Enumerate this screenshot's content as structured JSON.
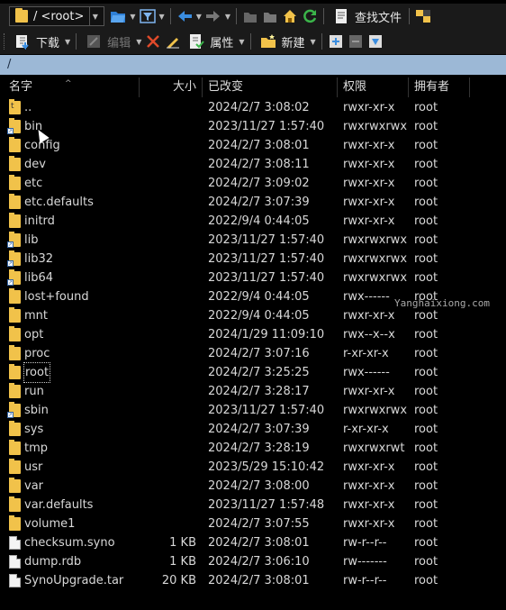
{
  "toolbar1": {
    "path_combo": "/ <root>",
    "find_files_label": "查找文件"
  },
  "toolbar2": {
    "download_label": "下载",
    "edit_label": "编辑",
    "properties_label": "属性",
    "new_label": "新建"
  },
  "current_path": "/",
  "columns": {
    "name": "名字",
    "size": "大小",
    "modified": "已改变",
    "permissions": "权限",
    "owner": "拥有者"
  },
  "files": [
    {
      "name": "..",
      "size": "",
      "modified": "2024/2/7 3:08:02",
      "permissions": "rwxr-xr-x",
      "owner": "root",
      "icon": "parent-folder-icon"
    },
    {
      "name": "bin",
      "size": "",
      "modified": "2023/11/27 1:57:40",
      "permissions": "rwxrwxrwx",
      "owner": "root",
      "icon": "symlink-icon"
    },
    {
      "name": "config",
      "size": "",
      "modified": "2024/2/7 3:08:01",
      "permissions": "rwxr-xr-x",
      "owner": "root",
      "icon": "folder-icon"
    },
    {
      "name": "dev",
      "size": "",
      "modified": "2024/2/7 3:08:11",
      "permissions": "rwxr-xr-x",
      "owner": "root",
      "icon": "folder-icon"
    },
    {
      "name": "etc",
      "size": "",
      "modified": "2024/2/7 3:09:02",
      "permissions": "rwxr-xr-x",
      "owner": "root",
      "icon": "folder-icon"
    },
    {
      "name": "etc.defaults",
      "size": "",
      "modified": "2024/2/7 3:07:39",
      "permissions": "rwxr-xr-x",
      "owner": "root",
      "icon": "folder-icon"
    },
    {
      "name": "initrd",
      "size": "",
      "modified": "2022/9/4 0:44:05",
      "permissions": "rwxr-xr-x",
      "owner": "root",
      "icon": "folder-icon"
    },
    {
      "name": "lib",
      "size": "",
      "modified": "2023/11/27 1:57:40",
      "permissions": "rwxrwxrwx",
      "owner": "root",
      "icon": "symlink-icon"
    },
    {
      "name": "lib32",
      "size": "",
      "modified": "2023/11/27 1:57:40",
      "permissions": "rwxrwxrwx",
      "owner": "root",
      "icon": "symlink-icon"
    },
    {
      "name": "lib64",
      "size": "",
      "modified": "2023/11/27 1:57:40",
      "permissions": "rwxrwxrwx",
      "owner": "root",
      "icon": "symlink-icon"
    },
    {
      "name": "lost+found",
      "size": "",
      "modified": "2022/9/4 0:44:05",
      "permissions": "rwx------",
      "owner": "root",
      "icon": "folder-icon"
    },
    {
      "name": "mnt",
      "size": "",
      "modified": "2022/9/4 0:44:05",
      "permissions": "rwxr-xr-x",
      "owner": "root",
      "icon": "folder-icon"
    },
    {
      "name": "opt",
      "size": "",
      "modified": "2024/1/29 11:09:10",
      "permissions": "rwx--x--x",
      "owner": "root",
      "icon": "folder-icon"
    },
    {
      "name": "proc",
      "size": "",
      "modified": "2024/2/7 3:07:16",
      "permissions": "r-xr-xr-x",
      "owner": "root",
      "icon": "folder-icon"
    },
    {
      "name": "root",
      "size": "",
      "modified": "2024/2/7 3:25:25",
      "permissions": "rwx------",
      "owner": "root",
      "icon": "folder-icon",
      "focused": true
    },
    {
      "name": "run",
      "size": "",
      "modified": "2024/2/7 3:28:17",
      "permissions": "rwxr-xr-x",
      "owner": "root",
      "icon": "folder-icon"
    },
    {
      "name": "sbin",
      "size": "",
      "modified": "2023/11/27 1:57:40",
      "permissions": "rwxrwxrwx",
      "owner": "root",
      "icon": "symlink-icon"
    },
    {
      "name": "sys",
      "size": "",
      "modified": "2024/2/7 3:07:39",
      "permissions": "r-xr-xr-x",
      "owner": "root",
      "icon": "folder-icon"
    },
    {
      "name": "tmp",
      "size": "",
      "modified": "2024/2/7 3:28:19",
      "permissions": "rwxrwxrwt",
      "owner": "root",
      "icon": "folder-icon"
    },
    {
      "name": "usr",
      "size": "",
      "modified": "2023/5/29 15:10:42",
      "permissions": "rwxr-xr-x",
      "owner": "root",
      "icon": "folder-icon"
    },
    {
      "name": "var",
      "size": "",
      "modified": "2024/2/7 3:08:00",
      "permissions": "rwxr-xr-x",
      "owner": "root",
      "icon": "folder-icon"
    },
    {
      "name": "var.defaults",
      "size": "",
      "modified": "2023/11/27 1:57:48",
      "permissions": "rwxr-xr-x",
      "owner": "root",
      "icon": "folder-icon"
    },
    {
      "name": "volume1",
      "size": "",
      "modified": "2024/2/7 3:07:55",
      "permissions": "rwxr-xr-x",
      "owner": "root",
      "icon": "folder-icon"
    },
    {
      "name": "checksum.syno",
      "size": "1 KB",
      "modified": "2024/2/7 3:08:01",
      "permissions": "rw-r--r--",
      "owner": "root",
      "icon": "file-icon"
    },
    {
      "name": "dump.rdb",
      "size": "1 KB",
      "modified": "2024/2/7 3:06:10",
      "permissions": "rw-------",
      "owner": "root",
      "icon": "file-icon"
    },
    {
      "name": "SynoUpgrade.tar",
      "size": "20 KB",
      "modified": "2024/2/7 3:08:01",
      "permissions": "rw-r--r--",
      "owner": "root",
      "icon": "file-icon"
    }
  ],
  "watermark": "Yanghaixiong.com",
  "colors": {
    "background": "#000000",
    "path_bar": "#9cb8d6",
    "folder": "#f1c24a",
    "accent_blue": "#3a8de0",
    "refresh_green": "#3bb54a"
  }
}
